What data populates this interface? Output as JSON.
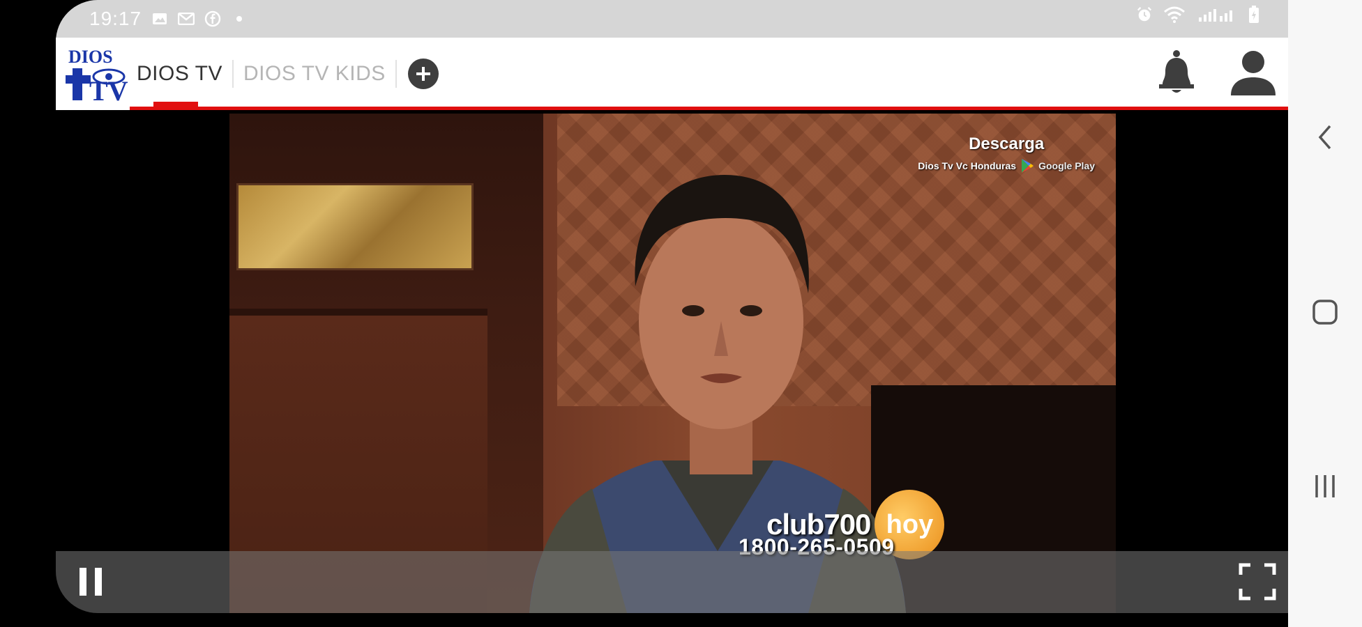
{
  "status_bar": {
    "time": "19:17",
    "left_icons": [
      "image-icon",
      "mail-icon",
      "facebook-icon",
      "dot-icon"
    ],
    "right_icons": [
      "alarm-icon",
      "wifi-icon",
      "signal-icon",
      "battery-icon"
    ]
  },
  "header": {
    "logo_text_top": "DIOS",
    "logo_text_bottom": "TV",
    "tabs": [
      {
        "label": "DIOS TV",
        "active": true
      },
      {
        "label": "DIOS TV KIDS",
        "active": false
      }
    ],
    "add_tab_icon": "plus-circle-icon",
    "notification_icon": "bell-icon",
    "profile_icon": "user-icon",
    "accent_color": "#e10f0f"
  },
  "video": {
    "overlay_title": "Descarga",
    "overlay_subtitle": "Dios Tv Vc Honduras",
    "store_label": "Google Play",
    "brand_club": "club700",
    "brand_hoy": "hoy",
    "phone": "1800-265-0509"
  },
  "player": {
    "pause_icon": "pause-icon",
    "fullscreen_icon": "fullscreen-icon"
  },
  "nav_bar": {
    "back_icon": "back-icon",
    "home_icon": "home-icon",
    "recents_icon": "recents-icon"
  }
}
